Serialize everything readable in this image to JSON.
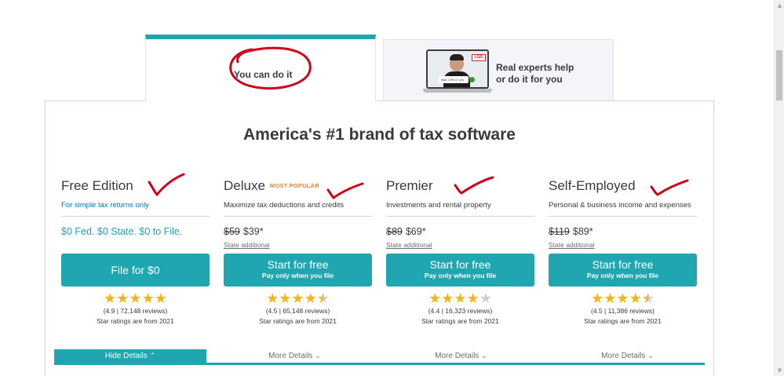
{
  "tabs": {
    "diy": {
      "label": "You can do it"
    },
    "expert": {
      "line1": "Real experts help",
      "line2": "or do it for you",
      "live_badge": "LIVE",
      "chip_text": "Neil, CPA 17 yrs"
    }
  },
  "panel": {
    "title": "America's #1 brand of tax software"
  },
  "products": [
    {
      "name": "Free Edition",
      "badge": "",
      "subtitle": "For simple tax returns only",
      "price_text": "$0 Fed. $0 State. $0 to File.",
      "cta_main": "File for $0",
      "cta_sub": "",
      "stars": 5,
      "rating_text": "(4.9 | 72,148 reviews)",
      "rating_note": "Star ratings are from 2021",
      "details_label": "Hide Details"
    },
    {
      "name": "Deluxe",
      "badge": "MOST POPULAR",
      "subtitle": "Maximize tax deductions and credits",
      "old_price": "$59",
      "new_price": "$39*",
      "state_note": "State additional",
      "cta_main": "Start for free",
      "cta_sub": "Pay only when you file",
      "stars": 4.5,
      "rating_text": "(4.5 | 65,148 reviews)",
      "rating_note": "Star ratings are from 2021",
      "details_label": "More Details"
    },
    {
      "name": "Premier",
      "badge": "",
      "subtitle": "Investments and rental property",
      "old_price": "$89",
      "new_price": "$69*",
      "state_note": "State additional",
      "cta_main": "Start for free",
      "cta_sub": "Pay only when you file",
      "stars": 4,
      "rating_text": "(4.4 | 16,323 reviews)",
      "rating_note": "Star ratings are from 2021",
      "details_label": "More Details"
    },
    {
      "name": "Self-Employed",
      "badge": "",
      "subtitle": "Personal & business income and expenses",
      "old_price": "$119",
      "new_price": "$89*",
      "state_note": "State additional",
      "cta_main": "Start for free",
      "cta_sub": "Pay only when you file",
      "stars": 4.5,
      "rating_text": "(4.5 | 11,386 reviews)",
      "rating_note": "Star ratings are from 2021",
      "details_label": "More Details"
    }
  ],
  "colors": {
    "accent": "#1fa6b0",
    "star": "#f2b51a",
    "popular": "#e5832c",
    "annotation": "#d0021b"
  },
  "icons": {
    "chevron_up": "chevron-up-icon",
    "chevron_down": "chevron-down-icon",
    "star": "star-icon"
  }
}
